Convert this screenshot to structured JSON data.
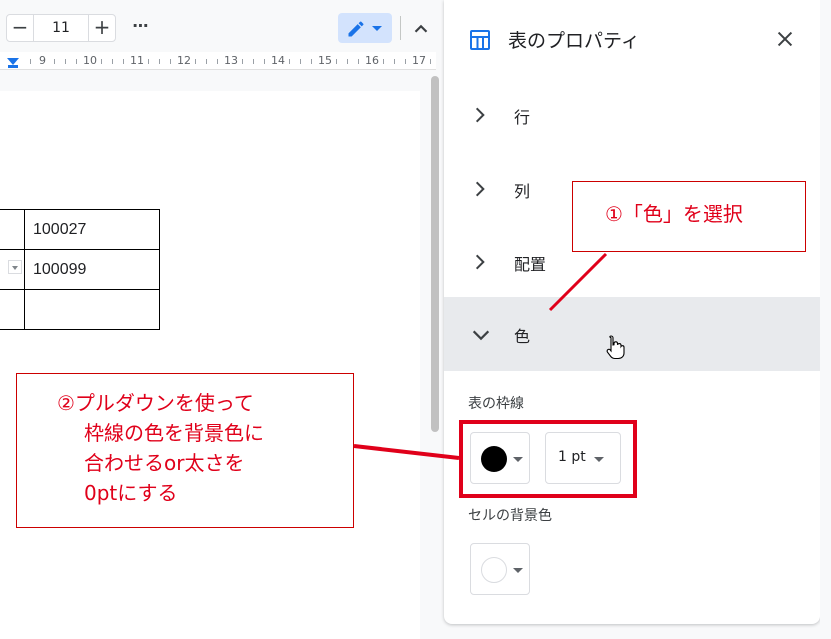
{
  "toolbar": {
    "font_size_decrease": "−",
    "font_size": "11",
    "font_size_increase": "+",
    "more": "⋯"
  },
  "ruler": {
    "labels": [
      "9",
      "10",
      "11",
      "12",
      "13",
      "14",
      "15",
      "16",
      "17"
    ]
  },
  "document": {
    "table_rows": [
      [
        "",
        "100027"
      ],
      [
        "",
        "100099"
      ],
      [
        "",
        ""
      ]
    ]
  },
  "panel": {
    "title": "表のプロパティ",
    "sections": [
      {
        "label": "行",
        "expanded": false
      },
      {
        "label": "列",
        "expanded": false
      },
      {
        "label": "配置",
        "expanded": false
      },
      {
        "label": "色",
        "expanded": true
      }
    ],
    "border_label": "表の枠線",
    "border_color": "#000000",
    "border_width": "1 pt",
    "cell_bg_label": "セルの背景色",
    "cell_bg_color": "#ffffff"
  },
  "annotations": {
    "note1": "①「色」を選択",
    "note2_lines": [
      "②プルダウンを使って",
      "枠線の色を背景色に",
      "合わせるor太さを",
      "0ptにする"
    ],
    "color": "#e0001a"
  },
  "colors": {
    "accent": "#1a73e8",
    "edit_mode_bg": "#d3e3fd",
    "section_hover": "#e8eaed"
  }
}
